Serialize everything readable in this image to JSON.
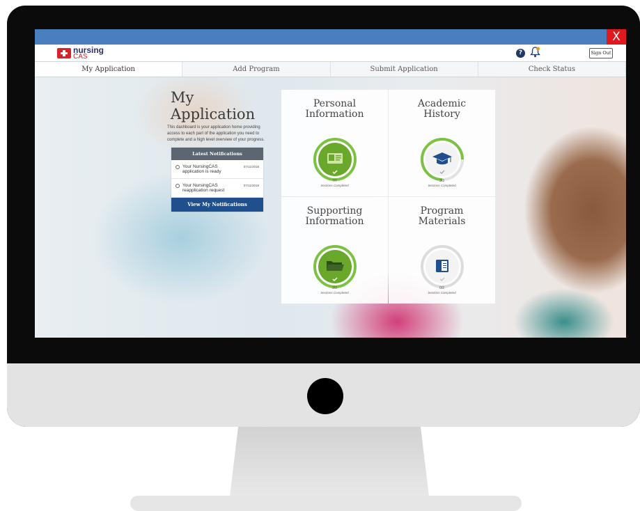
{
  "header": {
    "close_label": "X",
    "logo_line1": "nursing",
    "logo_line2": "CAS",
    "help_icon": "?",
    "signout_label": "Sign Out"
  },
  "tabs": [
    {
      "label": "My Application",
      "active": true
    },
    {
      "label": "Add Program",
      "active": false
    },
    {
      "label": "Submit Application",
      "active": false
    },
    {
      "label": "Check Status",
      "active": false
    }
  ],
  "intro": {
    "title": "My Application",
    "description": "This dashboard is your application home providing access to each part of the application you need to complete and a high level overview of your progress."
  },
  "notifications": {
    "heading": "Latest Notifications",
    "items": [
      {
        "text": "Your NursingCAS application is ready",
        "date": "07/11/2018"
      },
      {
        "text": "Your NursingCAS reapplication request",
        "date": "07/11/2018"
      }
    ],
    "button_label": "View My Notifications"
  },
  "sections": [
    {
      "title_line1": "Personal",
      "title_line2": "Information",
      "count": "7/7",
      "label": "Sections Completed",
      "icon": "id-card-icon",
      "status": "complete",
      "progress": 1.0
    },
    {
      "title_line1": "Academic",
      "title_line2": "History",
      "count": "3/3",
      "label": "Sections Completed",
      "icon": "graduation-cap-icon",
      "status": "in-progress",
      "progress": 1.0
    },
    {
      "title_line1": "Supporting",
      "title_line2": "Information",
      "count": "3/3",
      "label": "Sections Completed",
      "icon": "folder-icon",
      "status": "complete",
      "progress": 1.0
    },
    {
      "title_line1": "Program",
      "title_line2": "Materials",
      "count": "0/2",
      "label": "Sections Completed",
      "icon": "book-icon",
      "status": "not-started",
      "progress": 0.0
    }
  ],
  "colors": {
    "complete_green": "#6aa82c",
    "ring_green": "#7cc242",
    "navy": "#1f4f8c",
    "close_red": "#e0191e",
    "topbar_blue": "#4a7fbf"
  }
}
